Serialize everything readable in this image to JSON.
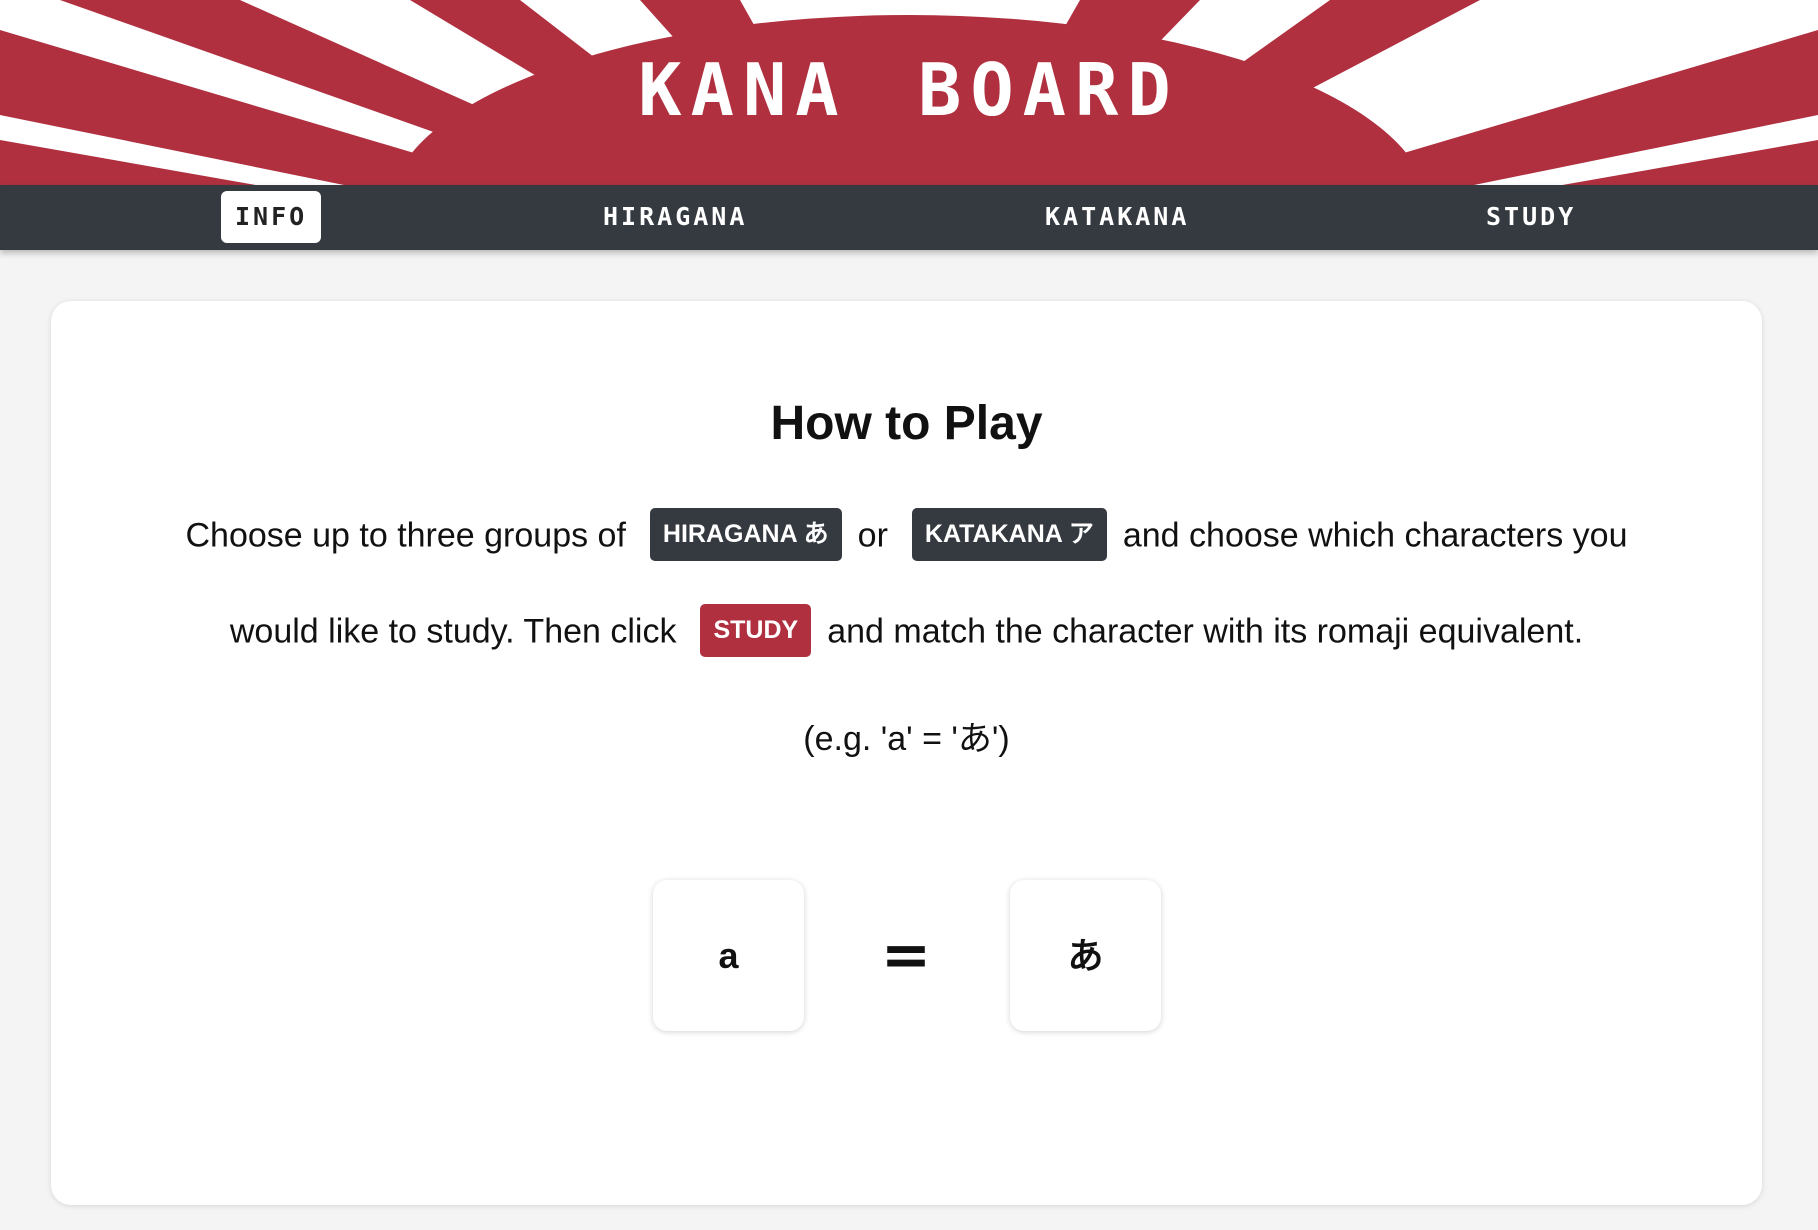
{
  "header": {
    "title": "KANA BOARD"
  },
  "colors": {
    "brand_red": "#b03040",
    "nav_dark": "#343a40"
  },
  "nav": {
    "items": [
      {
        "label": "INFO",
        "active": true
      },
      {
        "label": "HIRAGANA",
        "active": false
      },
      {
        "label": "KATAKANA",
        "active": false
      },
      {
        "label": "STUDY",
        "active": false
      }
    ]
  },
  "main": {
    "title": "How to Play",
    "line1": {
      "before": "Choose up to three groups of",
      "badge_hiragana": "HIRAGANA あ",
      "or": "or",
      "badge_katakana": "KATAKANA ア",
      "after": "and choose which characters you"
    },
    "line2": {
      "before": "would like to study. Then click",
      "badge_study": "STUDY",
      "after": "and match the character with its romaji equivalent."
    },
    "example": "(e.g. 'a' = 'あ')",
    "demo": {
      "romaji": "a",
      "equals": "=",
      "kana": "あ"
    }
  }
}
